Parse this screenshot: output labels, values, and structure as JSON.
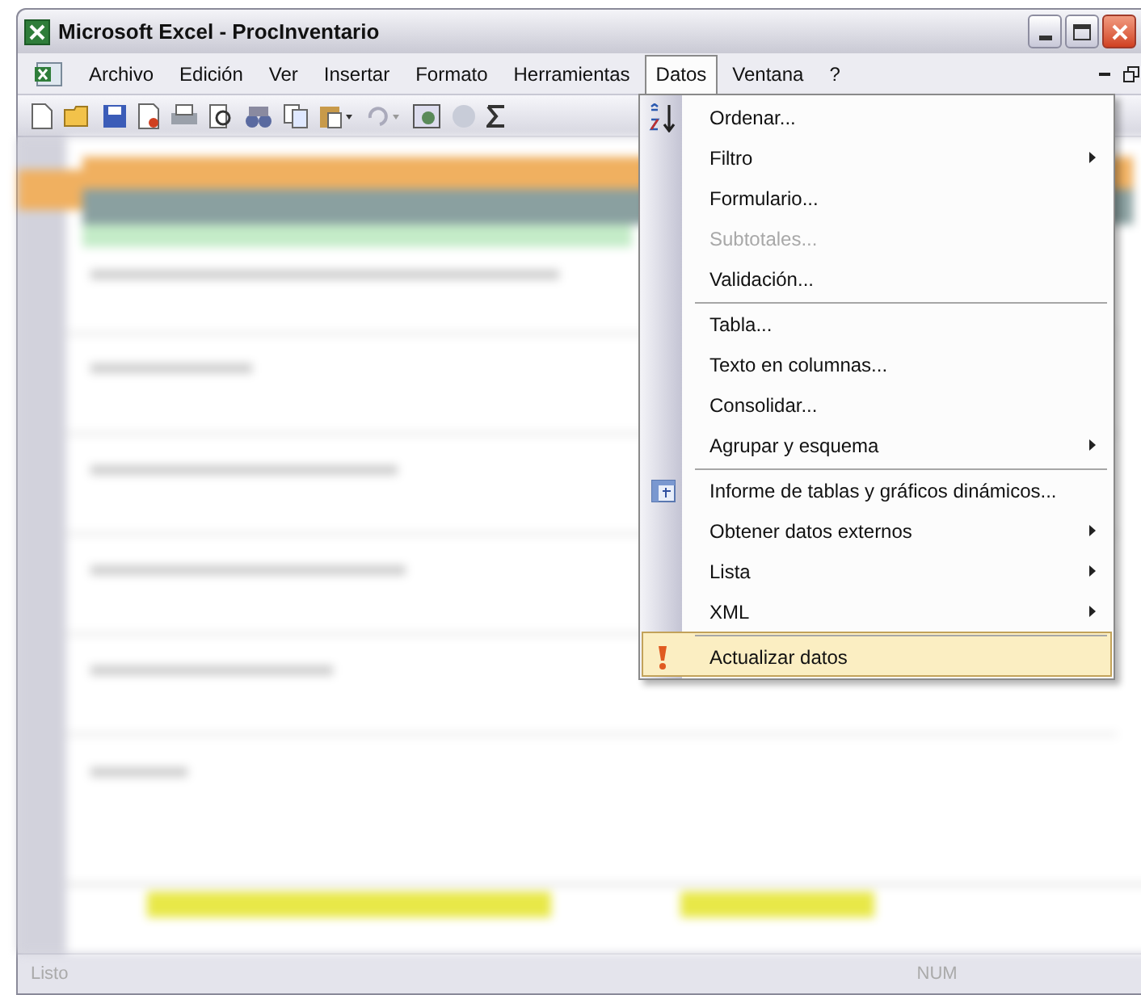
{
  "window": {
    "title": "Microsoft Excel - ProcInventario"
  },
  "menu_bar": [
    {
      "label": "Archivo",
      "selected": false
    },
    {
      "label": "Edición",
      "selected": false
    },
    {
      "label": "Ver",
      "selected": false
    },
    {
      "label": "Insertar",
      "selected": false
    },
    {
      "label": "Formato",
      "selected": false
    },
    {
      "label": "Herramientas",
      "selected": false
    },
    {
      "label": "Datos",
      "selected": true
    },
    {
      "label": "Ventana",
      "selected": false
    },
    {
      "label": "?",
      "selected": false
    }
  ],
  "datos_menu": [
    {
      "label": "Ordenar...",
      "disabled": false,
      "submenu": false,
      "separator_before": false,
      "selected": false
    },
    {
      "label": "Filtro",
      "disabled": false,
      "submenu": true,
      "separator_before": false,
      "selected": false
    },
    {
      "label": "Formulario...",
      "disabled": false,
      "submenu": false,
      "separator_before": false,
      "selected": false
    },
    {
      "label": "Subtotales...",
      "disabled": true,
      "submenu": false,
      "separator_before": false,
      "selected": false
    },
    {
      "label": "Validación...",
      "disabled": false,
      "submenu": false,
      "separator_before": false,
      "selected": false
    },
    {
      "label": "Tabla...",
      "disabled": false,
      "submenu": false,
      "separator_before": true,
      "selected": false
    },
    {
      "label": "Texto en columnas...",
      "disabled": false,
      "submenu": false,
      "separator_before": false,
      "selected": false
    },
    {
      "label": "Consolidar...",
      "disabled": false,
      "submenu": false,
      "separator_before": false,
      "selected": false
    },
    {
      "label": "Agrupar y esquema",
      "disabled": false,
      "submenu": true,
      "separator_before": false,
      "selected": false
    },
    {
      "label": "Informe de tablas y gráficos dinámicos...",
      "disabled": false,
      "submenu": false,
      "separator_before": true,
      "selected": false
    },
    {
      "label": "Obtener datos externos",
      "disabled": false,
      "submenu": true,
      "separator_before": false,
      "selected": false
    },
    {
      "label": "Lista",
      "disabled": false,
      "submenu": true,
      "separator_before": false,
      "selected": false
    },
    {
      "label": "XML",
      "disabled": false,
      "submenu": true,
      "separator_before": false,
      "selected": false
    },
    {
      "label": "Actualizar datos",
      "disabled": false,
      "submenu": false,
      "separator_before": true,
      "selected": true
    }
  ],
  "status_bar": {
    "status": "Listo",
    "indicator": "NUM"
  }
}
